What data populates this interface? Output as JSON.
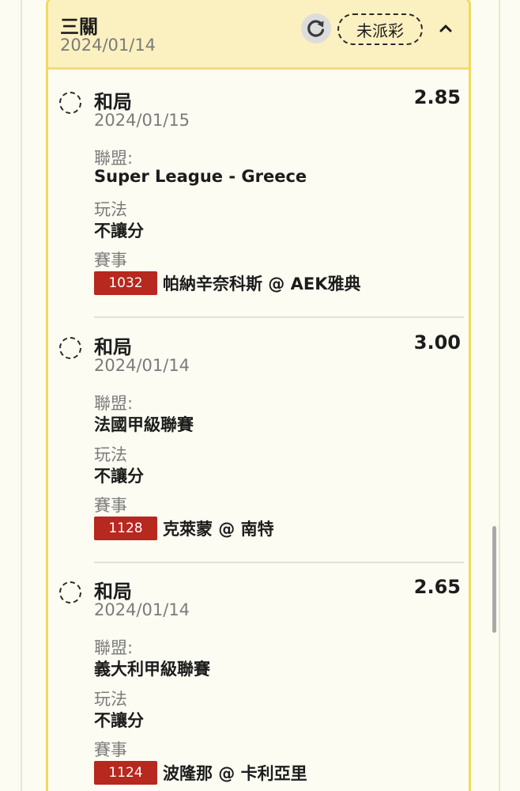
{
  "bet": {
    "type": "三關",
    "date": "2024/01/14",
    "status": "未派彩"
  },
  "legs": [
    {
      "selection": "和局",
      "odds": "2.85",
      "date": "2024/01/15",
      "league_label": "聯盟:",
      "league": "Super League - Greece",
      "bet_type_label": "玩法",
      "bet_type": "不讓分",
      "match_label": "賽事",
      "match_code": "1032",
      "match": "帕納辛奈科斯 @ AEK雅典"
    },
    {
      "selection": "和局",
      "odds": "3.00",
      "date": "2024/01/14",
      "league_label": "聯盟:",
      "league": "法國甲級聯賽",
      "bet_type_label": "玩法",
      "bet_type": "不讓分",
      "match_label": "賽事",
      "match_code": "1128",
      "match": "克萊蒙 @ 南特"
    },
    {
      "selection": "和局",
      "odds": "2.65",
      "date": "2024/01/14",
      "league_label": "聯盟:",
      "league": "義大利甲級聯賽",
      "bet_type_label": "玩法",
      "bet_type": "不讓分",
      "match_label": "賽事",
      "match_code": "1124",
      "match": "波隆那 @ 卡利亞里"
    }
  ],
  "icons": {
    "refresh": "refresh-icon",
    "collapse": "chevron-up-icon",
    "pending": "pending-dashed-circle-icon"
  },
  "colors": {
    "header_bg": "#fbf0c0",
    "card_border": "#f0da5f",
    "match_code_bg": "#b7281e"
  }
}
